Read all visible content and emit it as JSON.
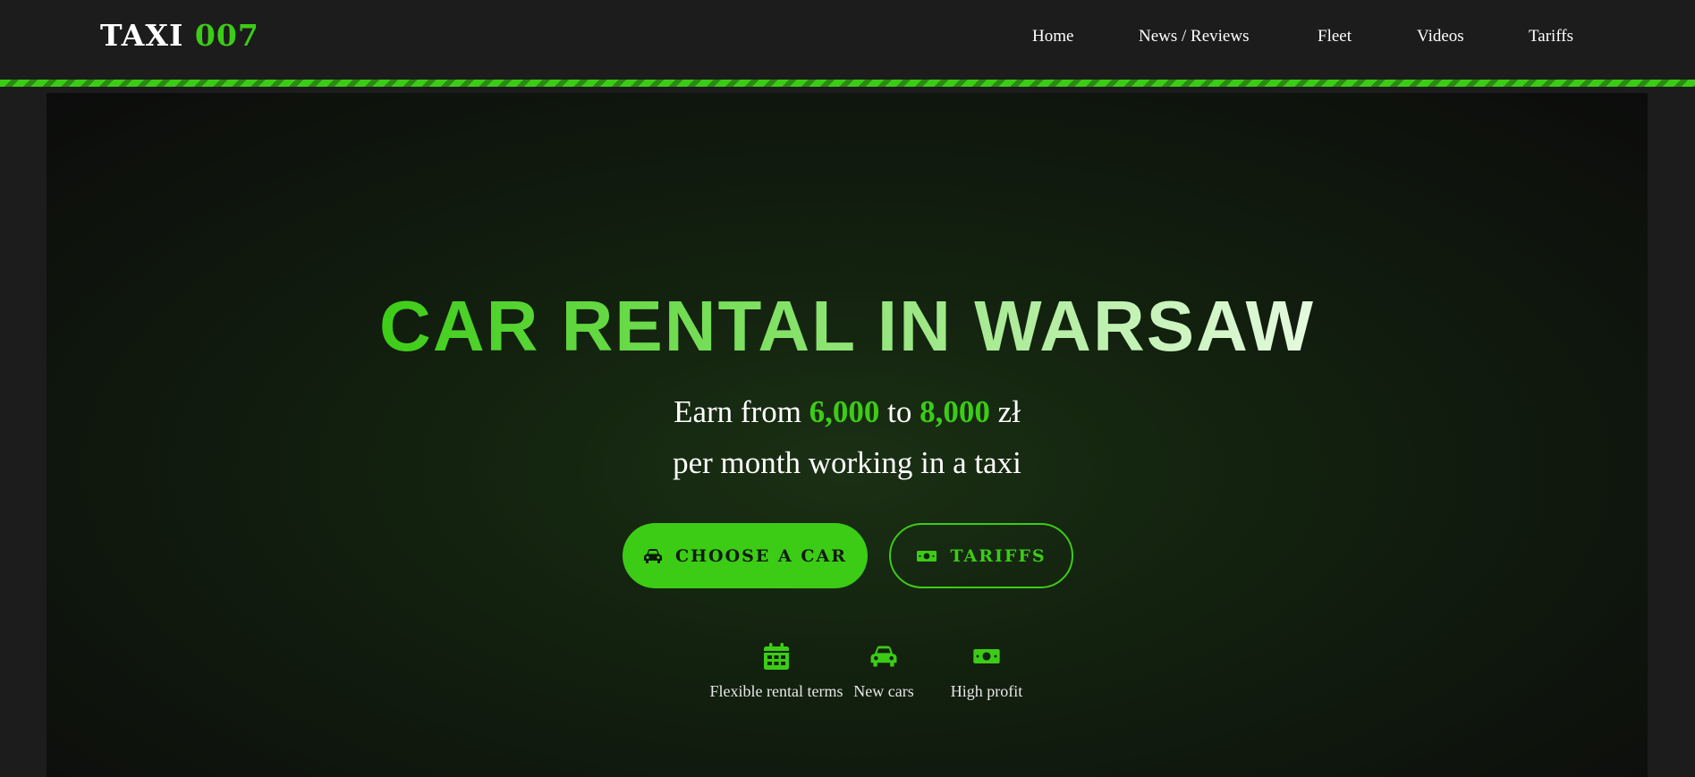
{
  "brand": {
    "name": "TAXI",
    "number": "007"
  },
  "nav": {
    "items": [
      "Home",
      "News / Reviews",
      "Fleet",
      "Videos",
      "Tariffs"
    ]
  },
  "hero": {
    "title": "CAR RENTAL IN WARSAW",
    "earn_prefix": "Earn from",
    "earn_min": "6,000",
    "earn_mid": "to",
    "earn_max": "8,000",
    "currency": "zł",
    "line2": "per month working in a taxi",
    "primary_button": "CHOOSE A CAR",
    "secondary_button": "TARIFFS"
  },
  "features": [
    {
      "icon": "calendar-icon",
      "label": "Flexible rental terms"
    },
    {
      "icon": "car-icon",
      "label": "New cars"
    },
    {
      "icon": "money-icon",
      "label": "High profit"
    }
  ],
  "colors": {
    "accent": "#3ccc16",
    "background": "#1c1c1c",
    "hero_dark": "#0c0c0c"
  }
}
